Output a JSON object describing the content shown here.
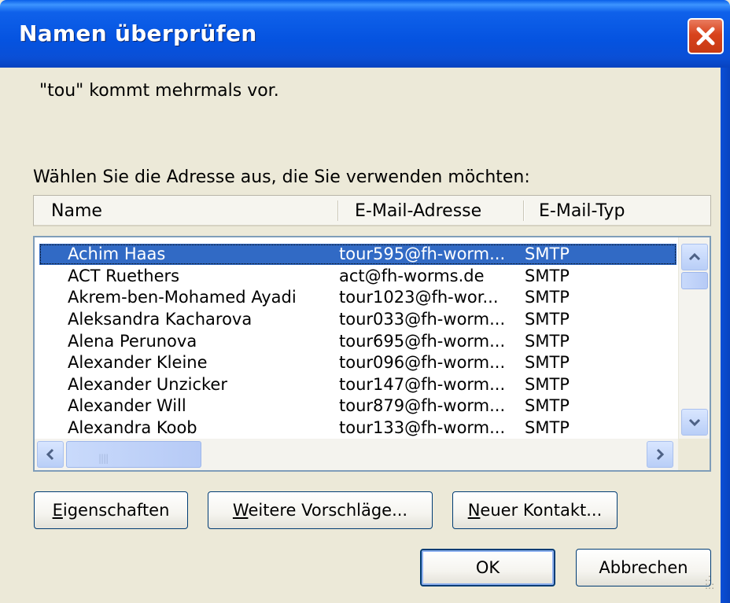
{
  "window": {
    "title": "Namen überprüfen"
  },
  "message": "\"tou\" kommt mehrmals vor.",
  "prompt": "Wählen Sie die Adresse aus, die Sie verwenden möchten:",
  "columns": {
    "name": "Name",
    "email": "E-Mail-Adresse",
    "type": "E-Mail-Typ"
  },
  "rows": [
    {
      "name": "Achim Haas",
      "email": "tour595@fh-worm...",
      "type": "SMTP",
      "selected": true
    },
    {
      "name": "ACT Ruethers",
      "email": "act@fh-worms.de",
      "type": "SMTP"
    },
    {
      "name": "Akrem-ben-Mohamed Ayadi",
      "email": "tour1023@fh-wor...",
      "type": "SMTP"
    },
    {
      "name": "Aleksandra Kacharova",
      "email": "tour033@fh-worm...",
      "type": "SMTP"
    },
    {
      "name": "Alena Perunova",
      "email": "tour695@fh-worm...",
      "type": "SMTP"
    },
    {
      "name": "Alexander Kleine",
      "email": "tour096@fh-worm...",
      "type": "SMTP"
    },
    {
      "name": "Alexander Unzicker",
      "email": "tour147@fh-worm...",
      "type": "SMTP"
    },
    {
      "name": "Alexander Will",
      "email": "tour879@fh-worm...",
      "type": "SMTP"
    },
    {
      "name": "Alexandra Koob",
      "email": "tour133@fh-worm...",
      "type": "SMTP"
    }
  ],
  "buttons": {
    "properties": {
      "first": "E",
      "rest": "igenschaften"
    },
    "more": {
      "first": "W",
      "rest": "eitere Vorschläge..."
    },
    "new_contact": {
      "first": "N",
      "rest": "euer Kontakt..."
    },
    "ok": "OK",
    "cancel": "Abbrechen"
  },
  "colors": {
    "titlebar": "#0553E0",
    "selection": "#316AC5",
    "close": "#D8431C",
    "dialog_bg": "#ECE9D8"
  },
  "icons": {
    "close": "close-icon",
    "scroll_up": "chevron-up-icon",
    "scroll_down": "chevron-down-icon",
    "scroll_left": "chevron-left-icon",
    "scroll_right": "chevron-right-icon"
  }
}
